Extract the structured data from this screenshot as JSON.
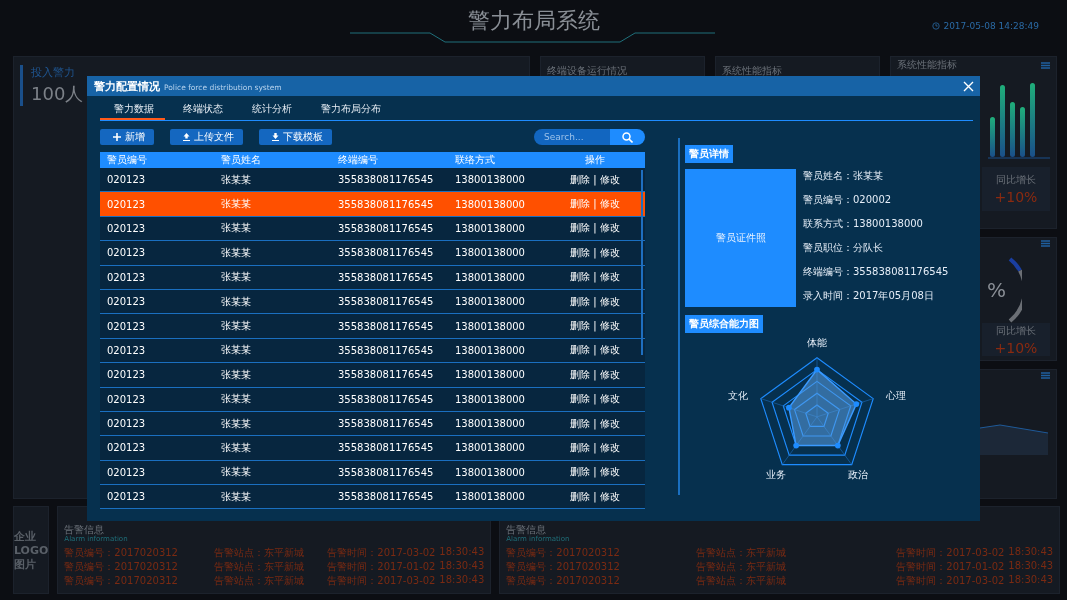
{
  "header": {
    "title": "警力布局系统",
    "datetime": "2017-05-08 14:28:49"
  },
  "force_panel": {
    "label": "投入警力",
    "value": "100人"
  },
  "top_panels": [
    {
      "title": "终端设备运行情况"
    },
    {
      "title": "系统性能指标"
    }
  ],
  "right_panels": [
    {
      "kind": "bars",
      "title": "系统性能指标",
      "growth_label": "同比增长",
      "growth_value": "+10%"
    },
    {
      "kind": "donut",
      "center": "%",
      "growth_label": "同比增长",
      "growth_value": "+10%"
    },
    {
      "kind": "area"
    }
  ],
  "logo": "企业LOGO图片",
  "alarm_panels": [
    {
      "title": "告警信息",
      "subtitle": "Alarm information",
      "rows": [
        [
          "警员编号：2017020312",
          "告警站点：东平新城",
          "告警时间：2017-03-02",
          "18:30:43"
        ],
        [
          "警员编号：2017020312",
          "告警站点：东平新城",
          "告警时间：2017-01-02",
          "18:30:43"
        ],
        [
          "警员编号：2017020312",
          "告警站点：东平新城",
          "告警时间：2017-03-02",
          "18:30:43"
        ]
      ]
    },
    {
      "title": "告警信息",
      "subtitle": "Alarm information",
      "rows": [
        [
          "警员编号：2017020312",
          "告警站点：东平新城",
          "告警时间：2017-03-02",
          "18:30:43"
        ],
        [
          "警员编号：2017020312",
          "告警站点：东平新城",
          "告警时间：2017-01-02",
          "18:30:43"
        ],
        [
          "警员编号：2017020312",
          "告警站点：东平新城",
          "告警时间：2017-03-02",
          "18:30:43"
        ]
      ]
    }
  ],
  "dialog": {
    "title": "警力配置情况",
    "subtitle": "Police force distribution system",
    "tabs": [
      {
        "label": "警力数据",
        "selected": true
      },
      {
        "label": "终端状态",
        "selected": false
      },
      {
        "label": "统计分析",
        "selected": false
      },
      {
        "label": "警力布局分布",
        "selected": false
      }
    ],
    "buttons": [
      {
        "kind": "add",
        "label": "新增"
      },
      {
        "kind": "upload",
        "label": "上传文件"
      },
      {
        "kind": "download",
        "label": "下载模板"
      }
    ],
    "search": {
      "placeholder": "Search..."
    },
    "table": {
      "columns": [
        "警员编号",
        "警员姓名",
        "终端编号",
        "联络方式",
        "操作"
      ],
      "rows": [
        {
          "cells": [
            "020123",
            "张某某",
            "355838081176545",
            "13800138000",
            "删除 | 修改"
          ],
          "selected": false
        },
        {
          "cells": [
            "020123",
            "张某某",
            "355838081176545",
            "13800138000",
            "删除 | 修改"
          ],
          "selected": true
        },
        {
          "cells": [
            "020123",
            "张某某",
            "355838081176545",
            "13800138000",
            "删除 | 修改"
          ],
          "selected": false
        },
        {
          "cells": [
            "020123",
            "张某某",
            "355838081176545",
            "13800138000",
            "删除 | 修改"
          ],
          "selected": false
        },
        {
          "cells": [
            "020123",
            "张某某",
            "355838081176545",
            "13800138000",
            "删除 | 修改"
          ],
          "selected": false
        },
        {
          "cells": [
            "020123",
            "张某某",
            "355838081176545",
            "13800138000",
            "删除 | 修改"
          ],
          "selected": false
        },
        {
          "cells": [
            "020123",
            "张某某",
            "355838081176545",
            "13800138000",
            "删除 | 修改"
          ],
          "selected": false
        },
        {
          "cells": [
            "020123",
            "张某某",
            "355838081176545",
            "13800138000",
            "删除 | 修改"
          ],
          "selected": false
        },
        {
          "cells": [
            "020123",
            "张某某",
            "355838081176545",
            "13800138000",
            "删除 | 修改"
          ],
          "selected": false
        },
        {
          "cells": [
            "020123",
            "张某某",
            "355838081176545",
            "13800138000",
            "删除 | 修改"
          ],
          "selected": false
        },
        {
          "cells": [
            "020123",
            "张某某",
            "355838081176545",
            "13800138000",
            "删除 | 修改"
          ],
          "selected": false
        },
        {
          "cells": [
            "020123",
            "张某某",
            "355838081176545",
            "13800138000",
            "删除 | 修改"
          ],
          "selected": false
        },
        {
          "cells": [
            "020123",
            "张某某",
            "355838081176545",
            "13800138000",
            "删除 | 修改"
          ],
          "selected": false
        },
        {
          "cells": [
            "020123",
            "张某某",
            "355838081176545",
            "13800138000",
            "删除 | 修改"
          ],
          "selected": false
        }
      ]
    },
    "detail": {
      "title": "警员详情",
      "photo_label": "警员证件照",
      "fields": [
        "警员姓名：张某某",
        "警员编号：020002",
        "联系方式：13800138000",
        "警员职位：分队长",
        "终端编号：355838081176545",
        "录入时间：2017年05月08日"
      ],
      "radar_title": "警员综合能力图",
      "radar_labels": [
        "体能",
        "心理",
        "政治",
        "业务",
        "文化"
      ]
    }
  }
}
